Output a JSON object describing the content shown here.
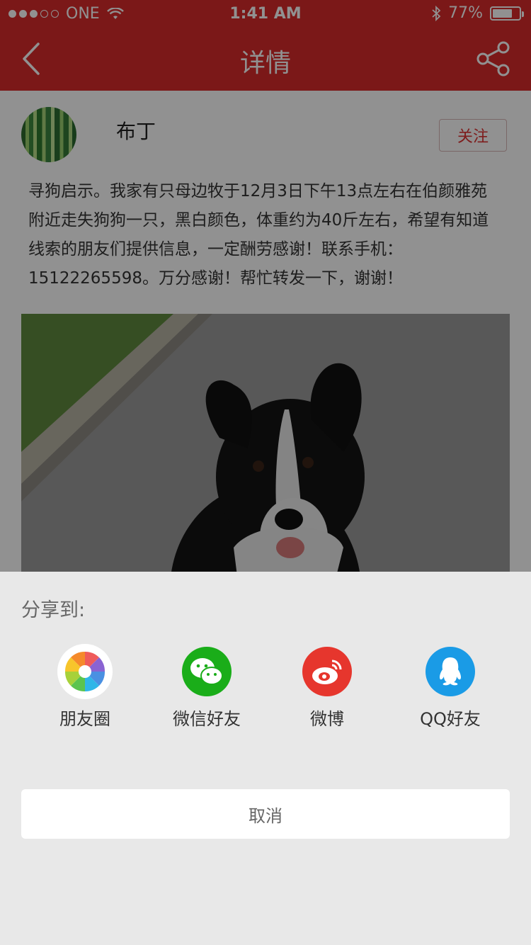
{
  "status": {
    "carrier": "ONE",
    "time": "1:41 AM",
    "battery": "77%",
    "battery_level": 0.77
  },
  "nav": {
    "title": "详情",
    "back_icon": "chevron-left-icon",
    "share_icon": "share-icon"
  },
  "post": {
    "username": "布丁",
    "follow_label": "关注",
    "text": "寻狗启示。我家有只母边牧于12月3日下午13点左右在伯颜雅苑附近走失狗狗一只，黑白颜色，体重约为40斤左右，希望有知道线索的朋友们提供信息，一定酬劳感谢！联系手机：15122265598。万分感谢！帮忙转发一下，谢谢！"
  },
  "share_sheet": {
    "title": "分享到:",
    "items": [
      {
        "label": "朋友圈",
        "icon": "moments-icon",
        "color": "#ffffff"
      },
      {
        "label": "微信好友",
        "icon": "wechat-icon",
        "color": "#1aad19"
      },
      {
        "label": "微博",
        "icon": "weibo-icon",
        "color": "#e6162d"
      },
      {
        "label": "QQ好友",
        "icon": "qq-icon",
        "color": "#12b7f5"
      }
    ],
    "cancel_label": "取消"
  },
  "colors": {
    "brand_red": "#d92b2b",
    "sheet_bg": "#e8e8e8"
  }
}
